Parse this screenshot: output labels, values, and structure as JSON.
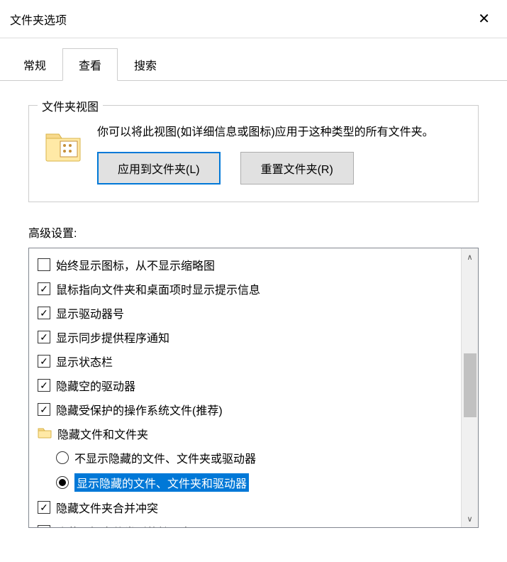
{
  "window": {
    "title": "文件夹选项"
  },
  "tabs": [
    {
      "label": "常规",
      "active": false
    },
    {
      "label": "查看",
      "active": true
    },
    {
      "label": "搜索",
      "active": false
    }
  ],
  "folderView": {
    "groupTitle": "文件夹视图",
    "description": "你可以将此视图(如详细信息或图标)应用于这种类型的所有文件夹。",
    "applyButton": "应用到文件夹(L)",
    "resetButton": "重置文件夹(R)"
  },
  "advanced": {
    "label": "高级设置:",
    "items": [
      {
        "kind": "checkbox",
        "checked": false,
        "indent": 1,
        "label": "始终显示图标，从不显示缩略图"
      },
      {
        "kind": "checkbox",
        "checked": true,
        "indent": 1,
        "label": "鼠标指向文件夹和桌面项时显示提示信息"
      },
      {
        "kind": "checkbox",
        "checked": true,
        "indent": 1,
        "label": "显示驱动器号"
      },
      {
        "kind": "checkbox",
        "checked": true,
        "indent": 1,
        "label": "显示同步提供程序通知"
      },
      {
        "kind": "checkbox",
        "checked": true,
        "indent": 1,
        "label": "显示状态栏"
      },
      {
        "kind": "checkbox",
        "checked": true,
        "indent": 1,
        "label": "隐藏空的驱动器"
      },
      {
        "kind": "checkbox",
        "checked": true,
        "indent": 1,
        "label": "隐藏受保护的操作系统文件(推荐)"
      },
      {
        "kind": "folder",
        "indent": 1,
        "label": "隐藏文件和文件夹"
      },
      {
        "kind": "radio",
        "selected": false,
        "indent": 2,
        "label": "不显示隐藏的文件、文件夹或驱动器"
      },
      {
        "kind": "radio",
        "selected": true,
        "indent": 2,
        "label": "显示隐藏的文件、文件夹和驱动器",
        "highlight": true
      },
      {
        "kind": "checkbox",
        "checked": true,
        "indent": 1,
        "label": "隐藏文件夹合并冲突"
      },
      {
        "kind": "checkbox",
        "checked": false,
        "indent": 1,
        "label": "隐藏已知文件类型的扩展名"
      }
    ]
  }
}
